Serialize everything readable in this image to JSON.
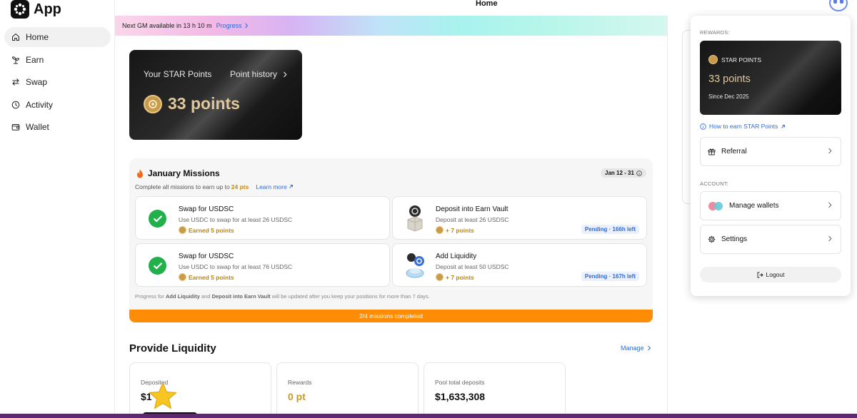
{
  "app": {
    "name": "App"
  },
  "header": {
    "title": "Home"
  },
  "sidebar": {
    "items": [
      {
        "label": "Home",
        "icon": "home-icon",
        "active": true
      },
      {
        "label": "Earn",
        "icon": "sprout-icon",
        "active": false
      },
      {
        "label": "Swap",
        "icon": "swap-arrows-icon",
        "active": false
      },
      {
        "label": "Activity",
        "icon": "clock-icon",
        "active": false
      },
      {
        "label": "Wallet",
        "icon": "wallet-icon",
        "active": false
      }
    ]
  },
  "banner": {
    "text": "Next GM available in 13 h 10 m",
    "link": "Progress"
  },
  "star_card": {
    "label": "Your STAR Points",
    "history": "Point history",
    "points": "33 points"
  },
  "missions": {
    "title": "January Missions",
    "date_range": "Jan 12 - 31",
    "subtitle_prefix": "Complete all missions to earn up to",
    "subtitle_points": "24 pts",
    "learn_more": "Learn more",
    "items": [
      {
        "title": "Swap for USDSC",
        "desc": "Use USDC to swap for at least 26 USDSC",
        "reward": "Earned 5 points",
        "status": ""
      },
      {
        "title": "Deposit into Earn Vault",
        "desc": "Deposit at least 26 USDSC",
        "reward": "+ 7 points",
        "status": "Pending · 166h left"
      },
      {
        "title": "Swap for USDSC",
        "desc": "Use USDC to swap for at least 76 USDSC",
        "reward": "Earned 5 points",
        "status": ""
      },
      {
        "title": "Add Liquidity",
        "desc": "Deposit at least 50 USDSC",
        "reward": "+ 7 points",
        "status": "Pending · 167h left"
      }
    ],
    "note_prefix": "Progress for",
    "note_b1": "Add Liquidity",
    "note_mid": "and",
    "note_b2": "Deposit into Earn Vault",
    "note_suffix": "will be updated after you keep your positions for more than 7 days.",
    "progress_text": "2/4 missions completed",
    "progress_fraction": 0.5
  },
  "liquidity": {
    "title": "Provide Liquidity",
    "manage": "Manage",
    "stats": [
      {
        "label": "Deposited",
        "value": "$1"
      },
      {
        "label": "Rewards",
        "value": "0 pt"
      },
      {
        "label": "Pool total deposits",
        "value": "$1,633,308"
      }
    ]
  },
  "panel": {
    "rewards_label": "REWARDS:",
    "card_title": "STAR POINTS",
    "card_value": "33 points",
    "card_since": "Since Dec 2025",
    "how_link": "How to earn STAR Points",
    "referral": "Referral",
    "account_label": "ACCOUNT:",
    "manage_wallets": "Manage wallets",
    "settings": "Settings",
    "logout": "Logout"
  },
  "colors": {
    "accent_blue": "#2f6ad9",
    "success_green": "#22b04b",
    "progress_orange": "#ff8c05",
    "gold": "#e1c79a"
  }
}
